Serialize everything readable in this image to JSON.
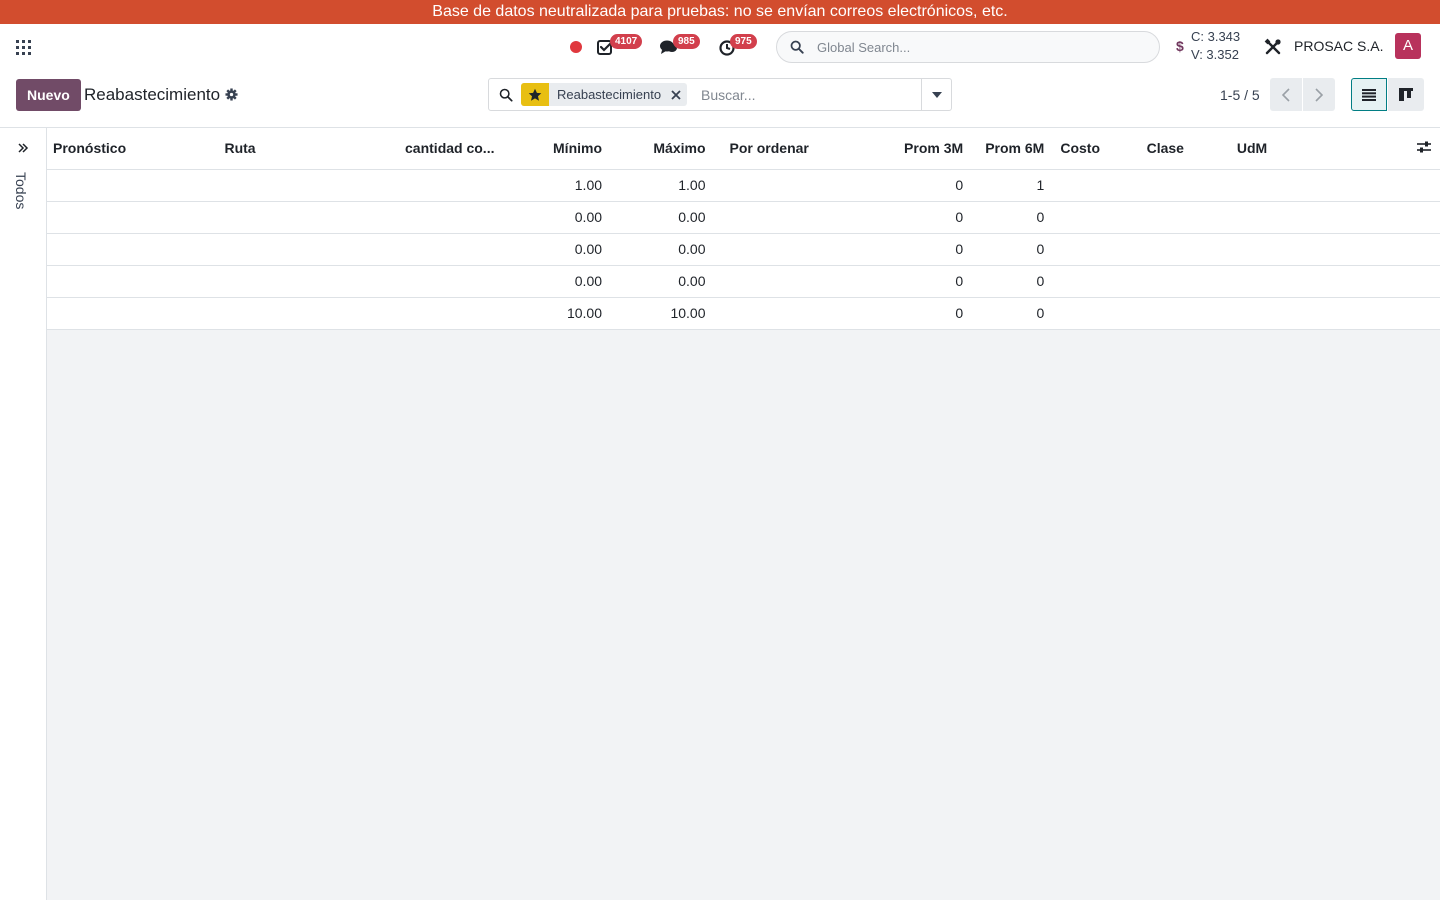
{
  "banner": {
    "text": "Base de datos neutralizada para pruebas: no se envían correos electrónicos, etc."
  },
  "navbar": {
    "activities_count": "4107",
    "messages_count": "985",
    "timers_count": "975",
    "search_placeholder": "Global Search...",
    "currency_symbol": "$",
    "rate_buy": "C: 3.343",
    "rate_sell": "V: 3.352",
    "company": "PROSAC S.A.",
    "avatar_initial": "A"
  },
  "control_panel": {
    "new_label": "Nuevo",
    "title": "Reabastecimiento",
    "facet_label": "Reabastecimiento",
    "search_placeholder": "Buscar...",
    "pager": "1-5 / 5"
  },
  "sidebar": {
    "label": "Todos"
  },
  "table": {
    "columns": [
      "Pronóstico",
      "Ruta",
      "cantidad co...",
      "Mínimo",
      "Máximo",
      "Por ordenar",
      "Prom 3M",
      "Prom 6M",
      "Costo",
      "Clase",
      "UdM"
    ],
    "rows": [
      [
        "",
        "",
        "",
        "1.00",
        "1.00",
        "",
        "0",
        "1",
        "",
        "",
        ""
      ],
      [
        "",
        "",
        "",
        "0.00",
        "0.00",
        "",
        "0",
        "0",
        "",
        "",
        ""
      ],
      [
        "",
        "",
        "",
        "0.00",
        "0.00",
        "",
        "0",
        "0",
        "",
        "",
        ""
      ],
      [
        "",
        "",
        "",
        "0.00",
        "0.00",
        "",
        "0",
        "0",
        "",
        "",
        ""
      ],
      [
        "",
        "",
        "",
        "10.00",
        "10.00",
        "",
        "0",
        "0",
        "",
        "",
        ""
      ]
    ]
  },
  "colors": {
    "banner": "#d24d2e",
    "primary": "#714b67",
    "badge": "#d23f4c",
    "accent": "#017e84",
    "facet_star": "#e8bf12",
    "avatar": "#b8325c"
  },
  "icons": [
    "apps-icon",
    "recording-dot-icon",
    "activity-check-icon",
    "chat-icon",
    "clock-icon",
    "search-icon",
    "dollar-icon",
    "tools-icon",
    "gear-icon",
    "star-icon",
    "close-icon",
    "caret-down-icon",
    "chevron-left-icon",
    "chevron-right-icon",
    "list-view-icon",
    "kanban-view-icon",
    "double-chevron-right-icon",
    "column-settings-icon"
  ]
}
